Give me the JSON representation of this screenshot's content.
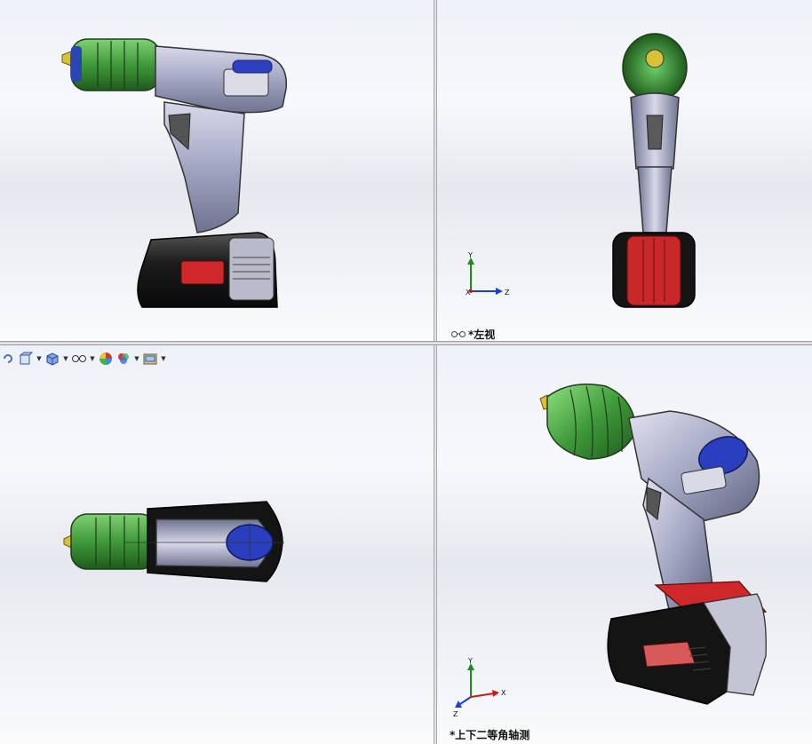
{
  "viewports": {
    "top_right": {
      "label": "*左视"
    },
    "bottom_right": {
      "label": "*上下二等角轴测"
    }
  },
  "triad_axes": {
    "top_right": [
      "Y",
      "X",
      "Z"
    ],
    "bottom_right": [
      "Y",
      "X",
      "Z"
    ]
  },
  "toolbar": {
    "buttons": [
      {
        "icon": "rotate-view-icon"
      },
      {
        "icon": "view-orientation-icon"
      },
      {
        "icon": "display-style-icon"
      },
      {
        "icon": "hide-show-items-icon"
      },
      {
        "icon": "edit-appearance-icon"
      },
      {
        "icon": "apply-scene-icon"
      },
      {
        "icon": "view-settings-icon"
      }
    ]
  },
  "colors": {
    "chuck_green": "#3f9a3a",
    "body_grey": "#a9acc6",
    "battery_black": "#1c1c1c",
    "battery_red": "#d0282a",
    "button_blue": "#2a3fbf",
    "axis_y": "#1f8a1f",
    "axis_x": "#d01818",
    "axis_z": "#1c3fd0"
  }
}
